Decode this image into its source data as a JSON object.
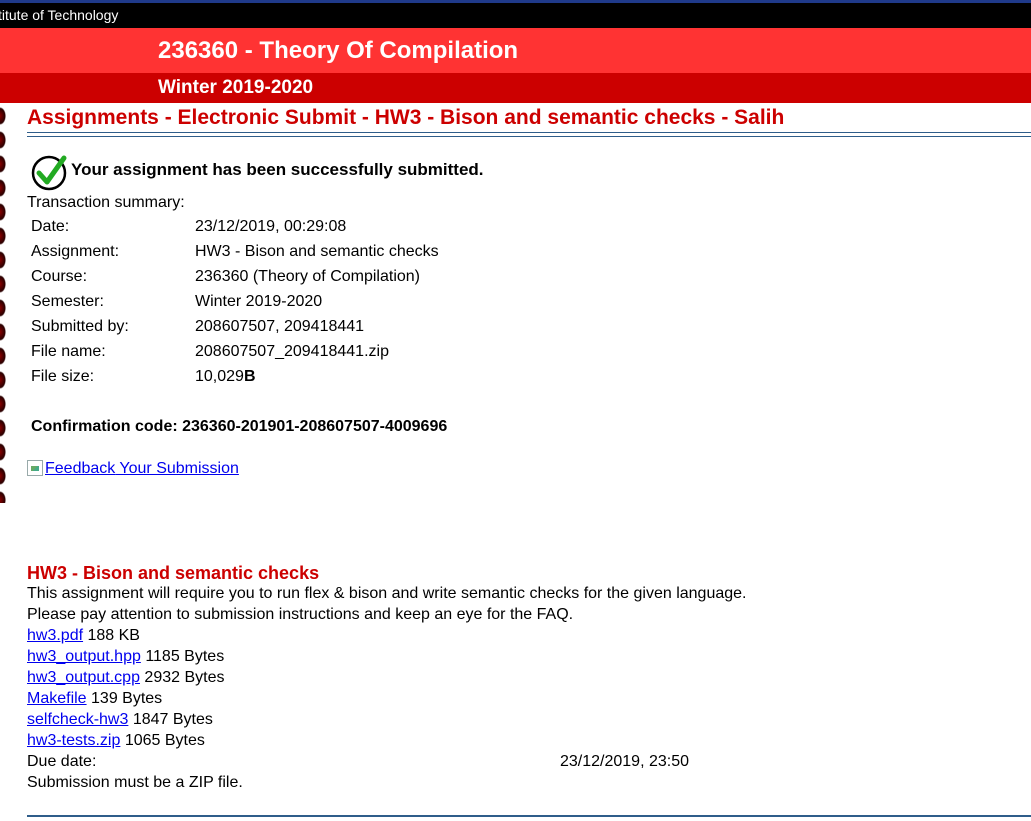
{
  "header": {
    "institute": "stitute of Technology",
    "course_title": "236360 - Theory Of Compilation",
    "semester_title": "Winter 2019-2020"
  },
  "page": {
    "heading": "Assignments - Electronic Submit - HW3 - Bison and semantic checks - Salih",
    "success_message": "Your assignment has been successfully submitted.",
    "summary_label": "Transaction summary:",
    "summary": [
      {
        "key": "Date:",
        "value": "23/12/2019, 00:29:08"
      },
      {
        "key": "Assignment:",
        "value": "HW3 - Bison and semantic checks"
      },
      {
        "key": "Course:",
        "value": "236360 (Theory of Compilation)"
      },
      {
        "key": "Semester:",
        "value": "Winter 2019-2020"
      },
      {
        "key": "Submitted by:",
        "value": "208607507, 209418441"
      },
      {
        "key": "File name:",
        "value": "208607507_209418441.zip"
      },
      {
        "key": "File size:",
        "value": "10,029"
      }
    ],
    "file_size_unit": "B",
    "confirmation": "Confirmation code: 236360-201901-208607507-4009696",
    "feedback_alt": "Feedback",
    "feedback_link": " Your Submission"
  },
  "assignment": {
    "title": "HW3 - Bison and semantic checks",
    "description_lines": [
      "This assignment will require you to run flex & bison and write semantic checks for the given language.",
      "Please pay attention to submission instructions and keep an eye for the FAQ."
    ],
    "files": [
      {
        "name": "hw3.pdf",
        "size": " 188 KB"
      },
      {
        "name": "hw3_output.hpp",
        "size": " 1185 Bytes"
      },
      {
        "name": "hw3_output.cpp",
        "size": " 2932 Bytes"
      },
      {
        "name": "Makefile",
        "size": " 139 Bytes"
      },
      {
        "name": "selfcheck-hw3",
        "size": " 1847 Bytes"
      },
      {
        "name": "hw3-tests.zip",
        "size": " 1065 Bytes"
      }
    ],
    "due_label": "Due date:",
    "due_value": "23/12/2019, 23:50",
    "zip_note": "Submission must be a ZIP file."
  },
  "colors": {
    "course_band": "#ff3333",
    "semester_band": "#cc0000",
    "heading_red": "#cc0000",
    "link": "#0000ee",
    "check_green": "#22aa22"
  },
  "icons": {
    "success": "checkmark-circle-icon",
    "feedback": "broken-image-icon"
  }
}
